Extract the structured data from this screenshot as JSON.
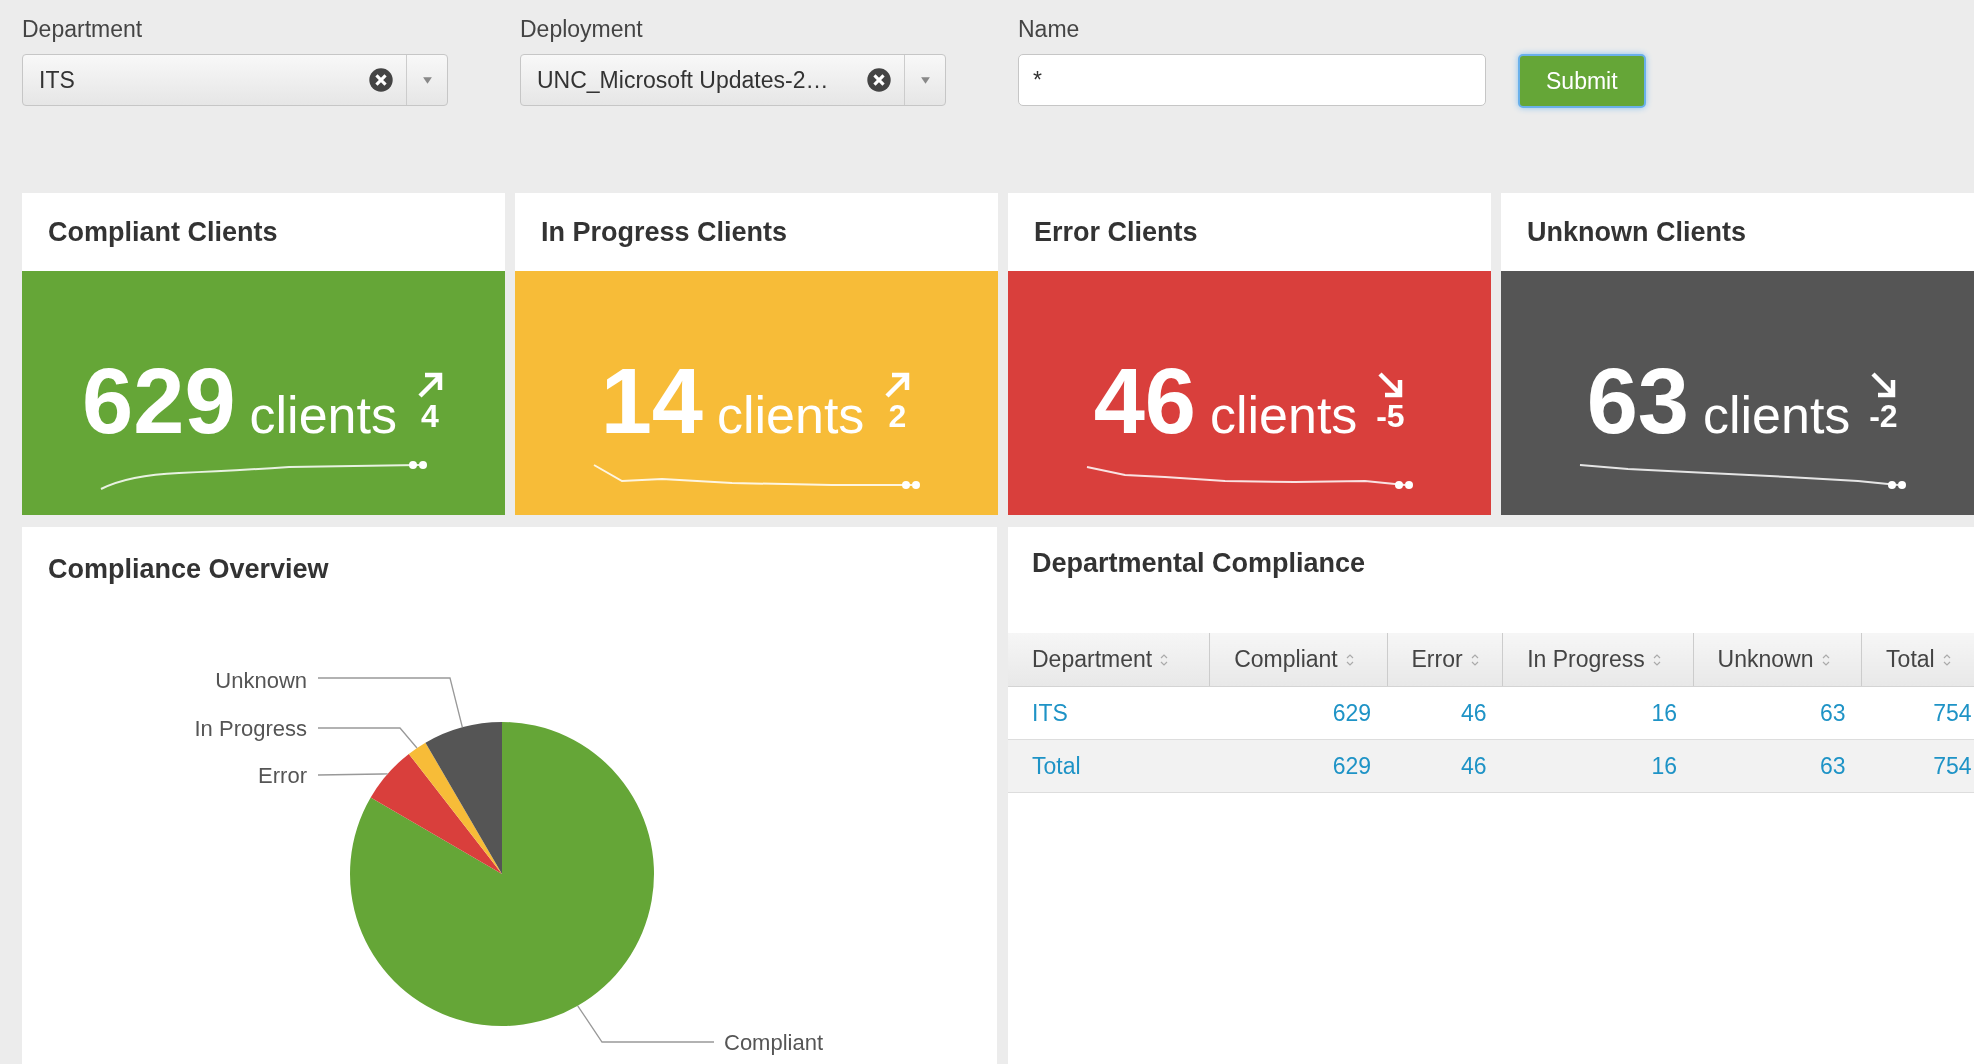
{
  "filters": [
    {
      "kind": "dropdown",
      "label": "Department",
      "value": "ITS"
    },
    {
      "kind": "dropdown",
      "label": "Deployment",
      "value": "UNC_Microsoft Updates-2…"
    },
    {
      "kind": "text",
      "label": "Name",
      "value": "*"
    }
  ],
  "submit": "Submit",
  "stats": [
    {
      "title": "Compliant Clients",
      "value": "629",
      "unit": "clients",
      "kind": "up",
      "delta": "4",
      "color": "#65a637"
    },
    {
      "title": "In Progress Clients",
      "value": "14",
      "unit": "clients",
      "kind": "up",
      "delta": "2",
      "color": "#f7bc38"
    },
    {
      "title": "Error Clients",
      "value": "46",
      "unit": "clients",
      "kind": "down",
      "delta": "-5",
      "color": "#d93f3c"
    },
    {
      "title": "Unknown Clients",
      "value": "63",
      "unit": "clients",
      "kind": "down",
      "delta": "-2",
      "color": "#555555"
    }
  ],
  "overview": {
    "title": "Compliance Overview",
    "chart_data": {
      "type": "pie",
      "categories": [
        "Compliant",
        "Error",
        "In Progress",
        "Unknown"
      ],
      "values": [
        83.4,
        6.1,
        2.1,
        8.4
      ]
    }
  },
  "departmental": {
    "title": "Departmental Compliance",
    "columns": [
      "Department",
      "Compliant",
      "Error",
      "In Progress",
      "Unknown",
      "Total"
    ],
    "rows": [
      [
        "ITS",
        "629",
        "46",
        "16",
        "63",
        "754"
      ],
      [
        "Total",
        "629",
        "46",
        "16",
        "63",
        "754"
      ]
    ]
  }
}
